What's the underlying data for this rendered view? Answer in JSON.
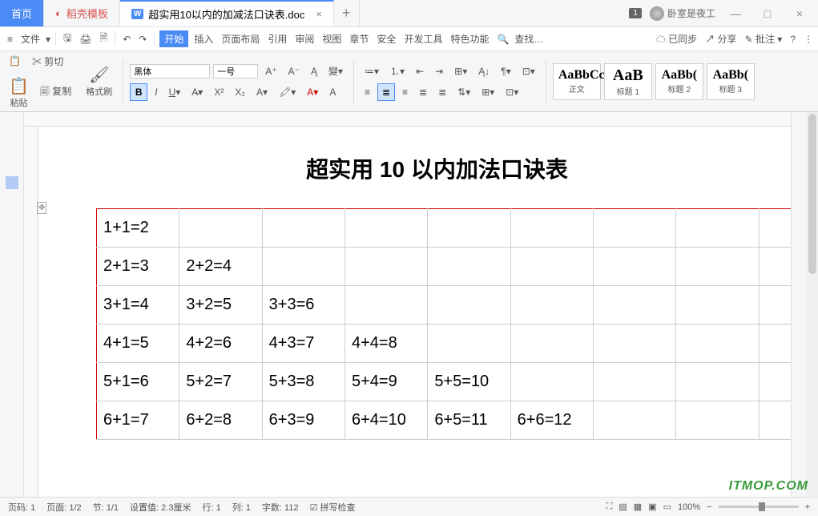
{
  "tabs": {
    "home": "首页",
    "template": "稻壳模板",
    "doc": "超实用10以内的加减法口诀表.doc"
  },
  "titlebar": {
    "badge": "1",
    "user": "卧室是夜工"
  },
  "menu": {
    "file": "文件",
    "start": "开始",
    "insert": "插入",
    "page": "页面布局",
    "ref": "引用",
    "review": "审阅",
    "view": "视图",
    "chapter": "章节",
    "safe": "安全",
    "dev": "开发工具",
    "special": "特色功能",
    "search": "查找…",
    "synced": "已同步",
    "share": "分享",
    "annotate": "批注"
  },
  "ribbon": {
    "cut": "剪切",
    "copy": "复制",
    "paste": "粘贴",
    "format": "格式刷",
    "font": "黑体",
    "size": "一号",
    "styles": {
      "normal": "正文",
      "h1": "标题 1",
      "h2": "标题 2",
      "h3": "标题 3"
    }
  },
  "doc": {
    "title": "超实用 10 以内加法口诀表",
    "rows": [
      [
        "1+1=2",
        "",
        "",
        "",
        "",
        "",
        "",
        "",
        ""
      ],
      [
        "2+1=3",
        "2+2=4",
        "",
        "",
        "",
        "",
        "",
        "",
        ""
      ],
      [
        "3+1=4",
        "3+2=5",
        "3+3=6",
        "",
        "",
        "",
        "",
        "",
        ""
      ],
      [
        "4+1=5",
        "4+2=6",
        "4+3=7",
        "4+4=8",
        "",
        "",
        "",
        "",
        ""
      ],
      [
        "5+1=6",
        "5+2=7",
        "5+3=8",
        "5+4=9",
        "5+5=10",
        "",
        "",
        "",
        ""
      ],
      [
        "6+1=7",
        "6+2=8",
        "6+3=9",
        "6+4=10",
        "6+5=11",
        "6+6=12",
        "",
        "",
        ""
      ]
    ]
  },
  "status": {
    "page_num": "页码: 1",
    "page": "页面: 1/2",
    "section": "节: 1/1",
    "setting": "设置值: 2.3厘米",
    "row": "行: 1",
    "col": "列: 1",
    "chars": "字数: 112",
    "spell": "拼写检查",
    "zoom": "100%"
  },
  "watermark": "ITMOP.COM"
}
